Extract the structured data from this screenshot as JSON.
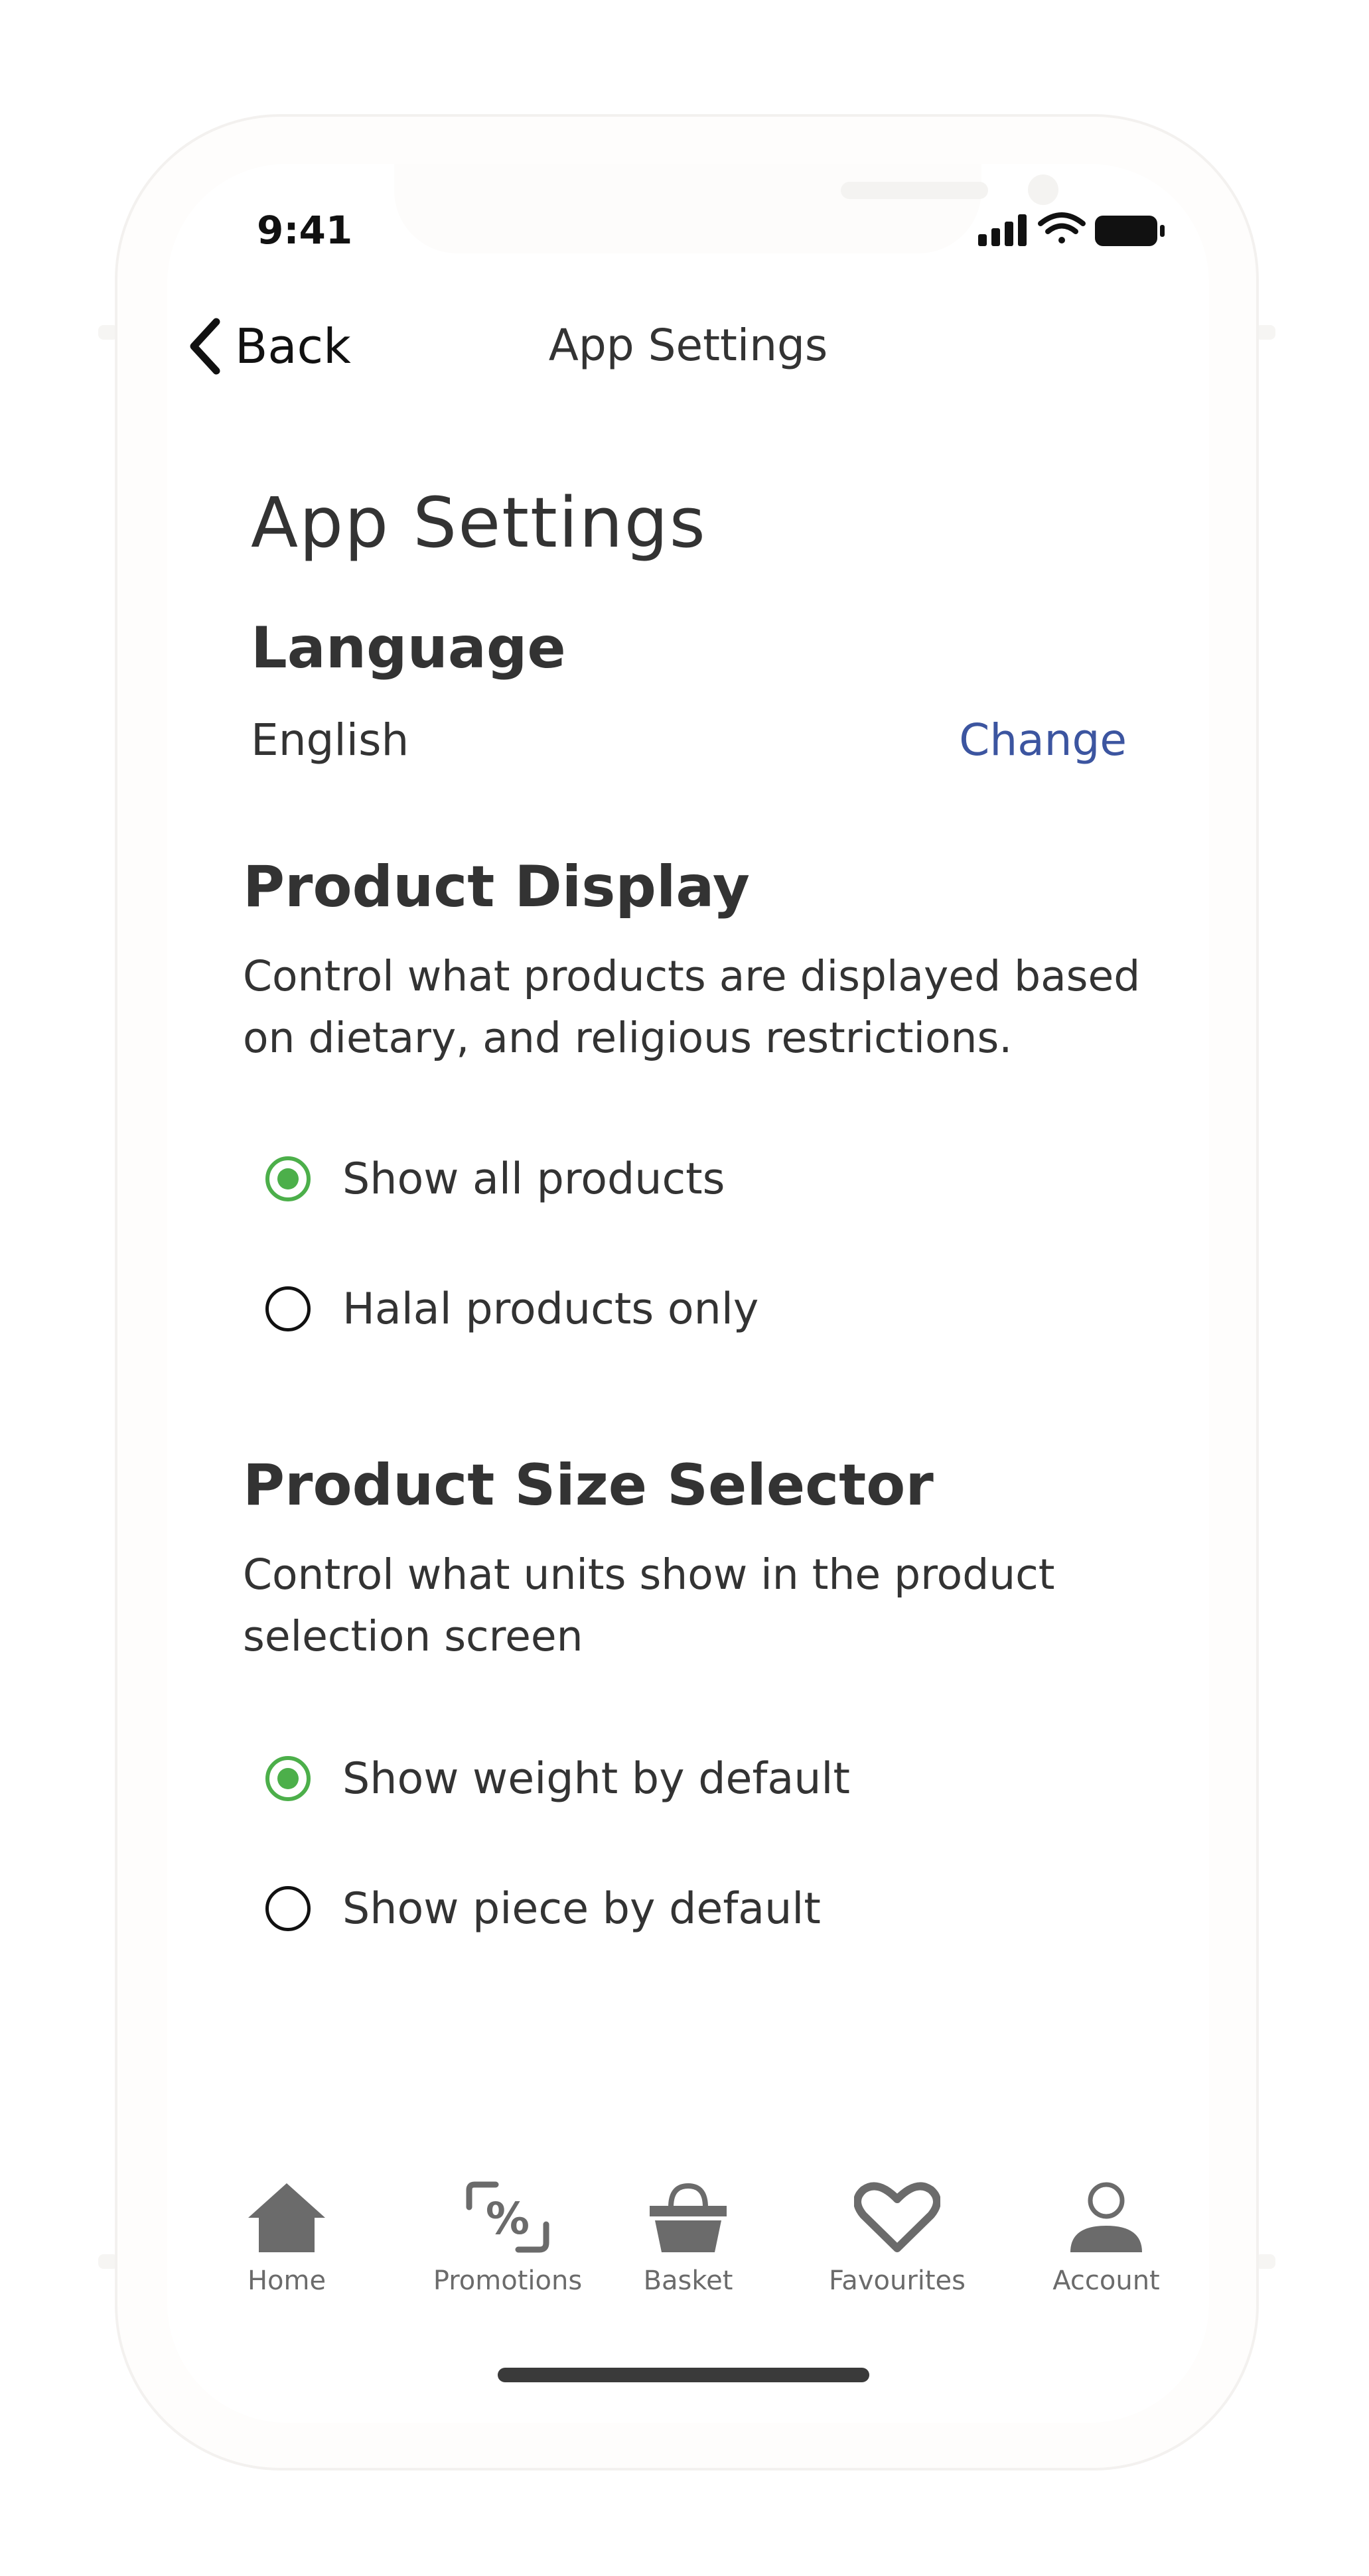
{
  "status_bar": {
    "time": "9:41"
  },
  "nav": {
    "back_label": "Back",
    "title": "App Settings"
  },
  "page": {
    "title": "App Settings"
  },
  "language": {
    "heading": "Language",
    "value": "English",
    "change_label": "Change"
  },
  "product_display": {
    "heading": "Product Display",
    "description_line1": "Control what products are displayed based",
    "description_line2": "on dietary, and religious restrictions.",
    "options": [
      {
        "label": "Show all products",
        "selected": true
      },
      {
        "label": "Halal products only",
        "selected": false
      }
    ]
  },
  "product_size": {
    "heading": "Product Size Selector",
    "description_line1": "Control what units show in the product",
    "description_line2": "selection screen",
    "options": [
      {
        "label": "Show weight by default",
        "selected": true
      },
      {
        "label": "Show piece by default",
        "selected": false
      }
    ]
  },
  "tabbar": {
    "items": [
      {
        "label": "Home",
        "icon": "home-icon"
      },
      {
        "label": "Promotions",
        "icon": "percent-tag-icon"
      },
      {
        "label": "Basket",
        "icon": "basket-icon"
      },
      {
        "label": "Favourites",
        "icon": "heart-icon"
      },
      {
        "label": "Account",
        "icon": "person-icon"
      }
    ]
  },
  "colors": {
    "accent_green": "#4caf4a",
    "link_blue": "#3c55a0",
    "text": "#333333",
    "tab_icon": "#6b6b6b"
  }
}
